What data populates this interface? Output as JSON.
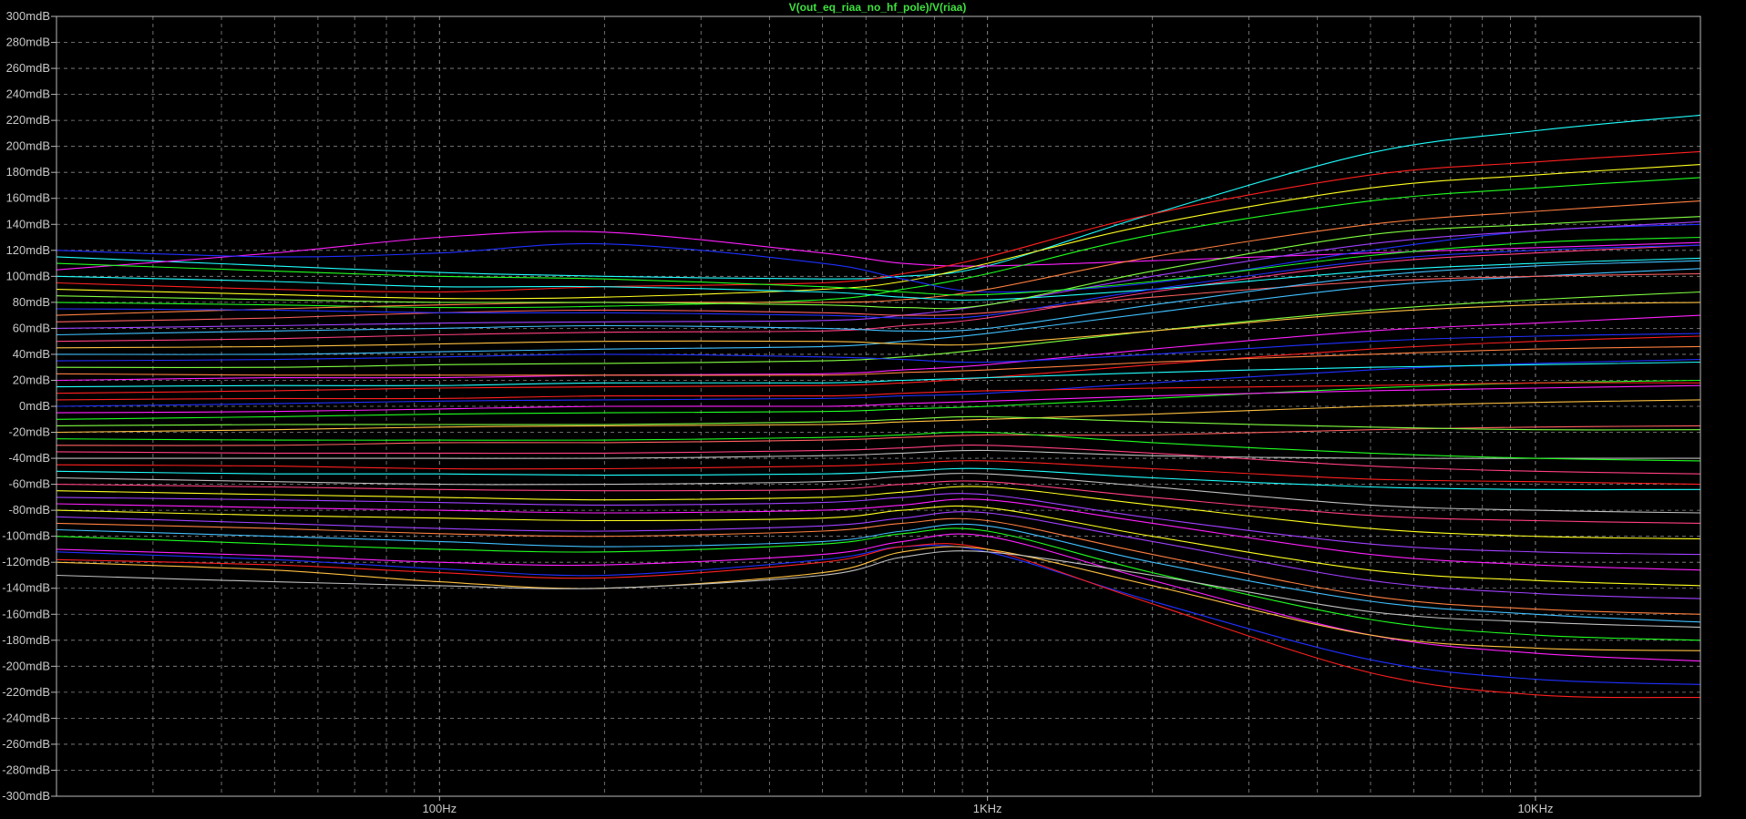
{
  "window": {
    "trace_expression": "V(out_eq_riaa_no_hf_pole)/V(riaa)"
  },
  "colors": {
    "background": "#000000",
    "grid": "#8a8a8a",
    "axis_text": "#c8c8c8",
    "title": "#3fe03f",
    "palette": [
      "#ff2020",
      "#20ff20",
      "#2030ff",
      "#ff20ff",
      "#20ffff",
      "#ffff20",
      "#ff8040",
      "#ff4080",
      "#80ff40",
      "#a040ff",
      "#ff6060",
      "#40c0ff",
      "#ffc040",
      "#c0c0c0"
    ]
  },
  "chart_data": {
    "type": "line",
    "title": "V(out_eq_riaa_no_hf_pole)/V(riaa)",
    "x_scale": "log",
    "xlim": [
      20,
      20000
    ],
    "ylim": [
      -300,
      300
    ],
    "y_unit": "mdB",
    "grid": true,
    "x_ticks": [
      {
        "value": 100,
        "label": "100Hz"
      },
      {
        "value": 1000,
        "label": "1KHz"
      },
      {
        "value": 10000,
        "label": "10KHz"
      }
    ],
    "y_ticks": [
      {
        "value": 300,
        "label": "300mdB"
      },
      {
        "value": 280,
        "label": "280mdB"
      },
      {
        "value": 260,
        "label": "260mdB"
      },
      {
        "value": 240,
        "label": "240mdB"
      },
      {
        "value": 220,
        "label": "220mdB"
      },
      {
        "value": 200,
        "label": "200mdB"
      },
      {
        "value": 180,
        "label": "180mdB"
      },
      {
        "value": 160,
        "label": "160mdB"
      },
      {
        "value": 140,
        "label": "140mdB"
      },
      {
        "value": 120,
        "label": "120mdB"
      },
      {
        "value": 100,
        "label": "100mdB"
      },
      {
        "value": 80,
        "label": "80mdB"
      },
      {
        "value": 60,
        "label": "60mdB"
      },
      {
        "value": 40,
        "label": "40mdB"
      },
      {
        "value": 20,
        "label": "20mdB"
      },
      {
        "value": 0,
        "label": "0mdB"
      },
      {
        "value": -20,
        "label": "-20mdB"
      },
      {
        "value": -40,
        "label": "-40mdB"
      },
      {
        "value": -60,
        "label": "-60mdB"
      },
      {
        "value": -80,
        "label": "-80mdB"
      },
      {
        "value": -100,
        "label": "-100mdB"
      },
      {
        "value": -120,
        "label": "-120mdB"
      },
      {
        "value": -140,
        "label": "-140mdB"
      },
      {
        "value": -160,
        "label": "-160mdB"
      },
      {
        "value": -180,
        "label": "-180mdB"
      },
      {
        "value": -200,
        "label": "-200mdB"
      },
      {
        "value": -220,
        "label": "-220mdB"
      },
      {
        "value": -240,
        "label": "-240mdB"
      },
      {
        "value": -260,
        "label": "-260mdB"
      },
      {
        "value": -280,
        "label": "-280mdB"
      },
      {
        "value": -300,
        "label": "-300mdB"
      }
    ],
    "x": [
      20,
      50,
      100,
      200,
      500,
      700,
      1000,
      2000,
      5000,
      10000,
      20000
    ],
    "series": [
      {
        "color": "#20ffff",
        "values": [
          115,
          108,
          103,
          100,
          98,
          100,
          108,
          148,
          195,
          212,
          224
        ]
      },
      {
        "color": "#ff20ff",
        "values": [
          105,
          118,
          130,
          134,
          118,
          110,
          108,
          112,
          118,
          122,
          126
        ]
      },
      {
        "color": "#ff2020",
        "values": [
          95,
          90,
          88,
          92,
          95,
          102,
          115,
          148,
          178,
          188,
          196
        ]
      },
      {
        "color": "#ffff20",
        "values": [
          90,
          86,
          83,
          84,
          90,
          96,
          110,
          140,
          168,
          178,
          186
        ]
      },
      {
        "color": "#20ff20",
        "values": [
          80,
          78,
          76,
          77,
          82,
          90,
          102,
          132,
          158,
          168,
          176
        ]
      },
      {
        "color": "#2030ff",
        "values": [
          120,
          115,
          118,
          125,
          110,
          98,
          88,
          95,
          120,
          135,
          140
        ]
      },
      {
        "color": "#ff8040",
        "values": [
          70,
          75,
          78,
          80,
          80,
          82,
          90,
          115,
          140,
          150,
          158
        ]
      },
      {
        "color": "#a040ff",
        "values": [
          60,
          62,
          64,
          65,
          66,
          70,
          78,
          100,
          125,
          135,
          142
        ]
      },
      {
        "color": "#ff4080",
        "values": [
          50,
          52,
          55,
          57,
          58,
          62,
          68,
          88,
          110,
          118,
          124
        ]
      },
      {
        "color": "#40c0ff",
        "values": [
          40,
          40,
          42,
          44,
          46,
          50,
          56,
          72,
          92,
          100,
          106
        ]
      },
      {
        "color": "#80ff40",
        "values": [
          30,
          30,
          32,
          33,
          35,
          38,
          44,
          58,
          74,
          82,
          88
        ]
      },
      {
        "color": "#ff20ff",
        "values": [
          20,
          22,
          22,
          24,
          25,
          28,
          32,
          44,
          58,
          64,
          70
        ]
      },
      {
        "color": "#ff2020",
        "values": [
          10,
          12,
          14,
          15,
          16,
          18,
          22,
          32,
          44,
          50,
          54
        ]
      },
      {
        "color": "#2030ff",
        "values": [
          0,
          2,
          4,
          5,
          6,
          8,
          10,
          18,
          28,
          33,
          36
        ]
      },
      {
        "color": "#20ff20",
        "values": [
          -10,
          -8,
          -6,
          -5,
          -4,
          -2,
          0,
          6,
          14,
          18,
          20
        ]
      },
      {
        "color": "#ffc040",
        "values": [
          -20,
          -18,
          -16,
          -15,
          -14,
          -12,
          -10,
          -6,
          0,
          3,
          5
        ]
      },
      {
        "color": "#ff6060",
        "values": [
          -30,
          -30,
          -28,
          -28,
          -26,
          -24,
          -22,
          -22,
          -18,
          -16,
          -15
        ]
      },
      {
        "color": "#c0c0c0",
        "values": [
          -40,
          -40,
          -40,
          -40,
          -38,
          -36,
          -34,
          -38,
          -40,
          -40,
          -40
        ]
      },
      {
        "color": "#20ffff",
        "values": [
          -50,
          -52,
          -52,
          -53,
          -52,
          -50,
          -48,
          -55,
          -62,
          -64,
          -64
        ]
      },
      {
        "color": "#ff4080",
        "values": [
          -60,
          -62,
          -64,
          -65,
          -64,
          -60,
          -58,
          -70,
          -84,
          -88,
          -90
        ]
      },
      {
        "color": "#a040ff",
        "values": [
          -70,
          -72,
          -74,
          -76,
          -74,
          -70,
          -68,
          -86,
          -106,
          -112,
          -114
        ]
      },
      {
        "color": "#ffff20",
        "values": [
          -80,
          -84,
          -86,
          -88,
          -86,
          -80,
          -78,
          -100,
          -126,
          -134,
          -138
        ]
      },
      {
        "color": "#ff8040",
        "values": [
          -90,
          -94,
          -98,
          -100,
          -96,
          -90,
          -88,
          -114,
          -146,
          -156,
          -160
        ]
      },
      {
        "color": "#20ff20",
        "values": [
          -100,
          -106,
          -110,
          -112,
          -106,
          -98,
          -96,
          -128,
          -164,
          -176,
          -180
        ]
      },
      {
        "color": "#40c0ff",
        "values": [
          -95,
          -100,
          -104,
          -108,
          -104,
          -96,
          -92,
          -120,
          -150,
          -160,
          -166
        ]
      },
      {
        "color": "#ff20ff",
        "values": [
          -110,
          -115,
          -120,
          -122,
          -114,
          -104,
          -100,
          -134,
          -176,
          -190,
          -196
        ]
      },
      {
        "color": "#2030ff",
        "values": [
          -112,
          -118,
          -125,
          -130,
          -118,
          -108,
          -112,
          -150,
          -195,
          -210,
          -214
        ]
      },
      {
        "color": "#ff2020",
        "values": [
          -118,
          -122,
          -128,
          -132,
          -120,
          -108,
          -110,
          -152,
          -205,
          -222,
          -224
        ]
      },
      {
        "color": "#ffc040",
        "values": [
          -120,
          -126,
          -135,
          -140,
          -128,
          -112,
          -110,
          -138,
          -176,
          -186,
          -188
        ]
      },
      {
        "color": "#c0c0c0",
        "values": [
          -130,
          -135,
          -138,
          -140,
          -130,
          -116,
          -112,
          -130,
          -158,
          -166,
          -170
        ]
      },
      {
        "color": "#20ffff",
        "values": [
          100,
          96,
          92,
          92,
          88,
          84,
          82,
          90,
          104,
          110,
          114
        ]
      },
      {
        "color": "#80ff40",
        "values": [
          85,
          82,
          80,
          80,
          78,
          76,
          78,
          104,
          132,
          140,
          146
        ]
      },
      {
        "color": "#ff6060",
        "values": [
          65,
          68,
          72,
          74,
          72,
          70,
          72,
          84,
          96,
          100,
          102
        ]
      },
      {
        "color": "#2030ff",
        "values": [
          35,
          36,
          38,
          40,
          38,
          36,
          34,
          40,
          50,
          54,
          56
        ]
      },
      {
        "color": "#ff20ff",
        "values": [
          -5,
          -4,
          -2,
          0,
          0,
          2,
          4,
          8,
          12,
          14,
          16
        ]
      },
      {
        "color": "#20ff20",
        "values": [
          -25,
          -26,
          -26,
          -26,
          -24,
          -22,
          -20,
          -28,
          -36,
          -40,
          -42
        ]
      },
      {
        "color": "#ff2020",
        "values": [
          -45,
          -46,
          -48,
          -48,
          -46,
          -44,
          -42,
          -48,
          -56,
          -58,
          -60
        ]
      },
      {
        "color": "#ffff20",
        "values": [
          -65,
          -68,
          -70,
          -72,
          -70,
          -66,
          -62,
          -76,
          -94,
          -100,
          -102
        ]
      },
      {
        "color": "#a040ff",
        "values": [
          -85,
          -90,
          -94,
          -96,
          -92,
          -86,
          -82,
          -104,
          -134,
          -144,
          -148
        ]
      },
      {
        "color": "#40c0ff",
        "values": [
          55,
          58,
          60,
          62,
          60,
          58,
          60,
          78,
          100,
          108,
          112
        ]
      },
      {
        "color": "#ff8040",
        "values": [
          25,
          24,
          24,
          24,
          24,
          26,
          28,
          34,
          40,
          44,
          46
        ]
      },
      {
        "color": "#80ff40",
        "values": [
          -15,
          -14,
          -14,
          -14,
          -12,
          -10,
          -8,
          -12,
          -16,
          -18,
          -18
        ]
      },
      {
        "color": "#ff4080",
        "values": [
          -35,
          -36,
          -36,
          -36,
          -34,
          -32,
          -30,
          -36,
          -46,
          -50,
          -52
        ]
      },
      {
        "color": "#c0c0c0",
        "values": [
          -55,
          -58,
          -60,
          -60,
          -58,
          -54,
          -52,
          -62,
          -76,
          -80,
          -82
        ]
      },
      {
        "color": "#ff20ff",
        "values": [
          -75,
          -78,
          -80,
          -82,
          -80,
          -76,
          -72,
          -90,
          -114,
          -122,
          -126
        ]
      },
      {
        "color": "#2030ff",
        "values": [
          75,
          74,
          72,
          72,
          70,
          68,
          70,
          90,
          112,
          120,
          124
        ]
      },
      {
        "color": "#ffc040",
        "values": [
          45,
          46,
          48,
          50,
          50,
          48,
          48,
          58,
          72,
          78,
          80
        ]
      },
      {
        "color": "#20ffff",
        "values": [
          15,
          16,
          16,
          18,
          18,
          20,
          22,
          26,
          30,
          32,
          34
        ]
      },
      {
        "color": "#ff2020",
        "values": [
          5,
          6,
          6,
          8,
          8,
          10,
          12,
          14,
          16,
          18,
          18
        ]
      },
      {
        "color": "#20ff20",
        "values": [
          110,
          104,
          100,
          98,
          92,
          88,
          86,
          96,
          116,
          126,
          130
        ]
      }
    ]
  }
}
